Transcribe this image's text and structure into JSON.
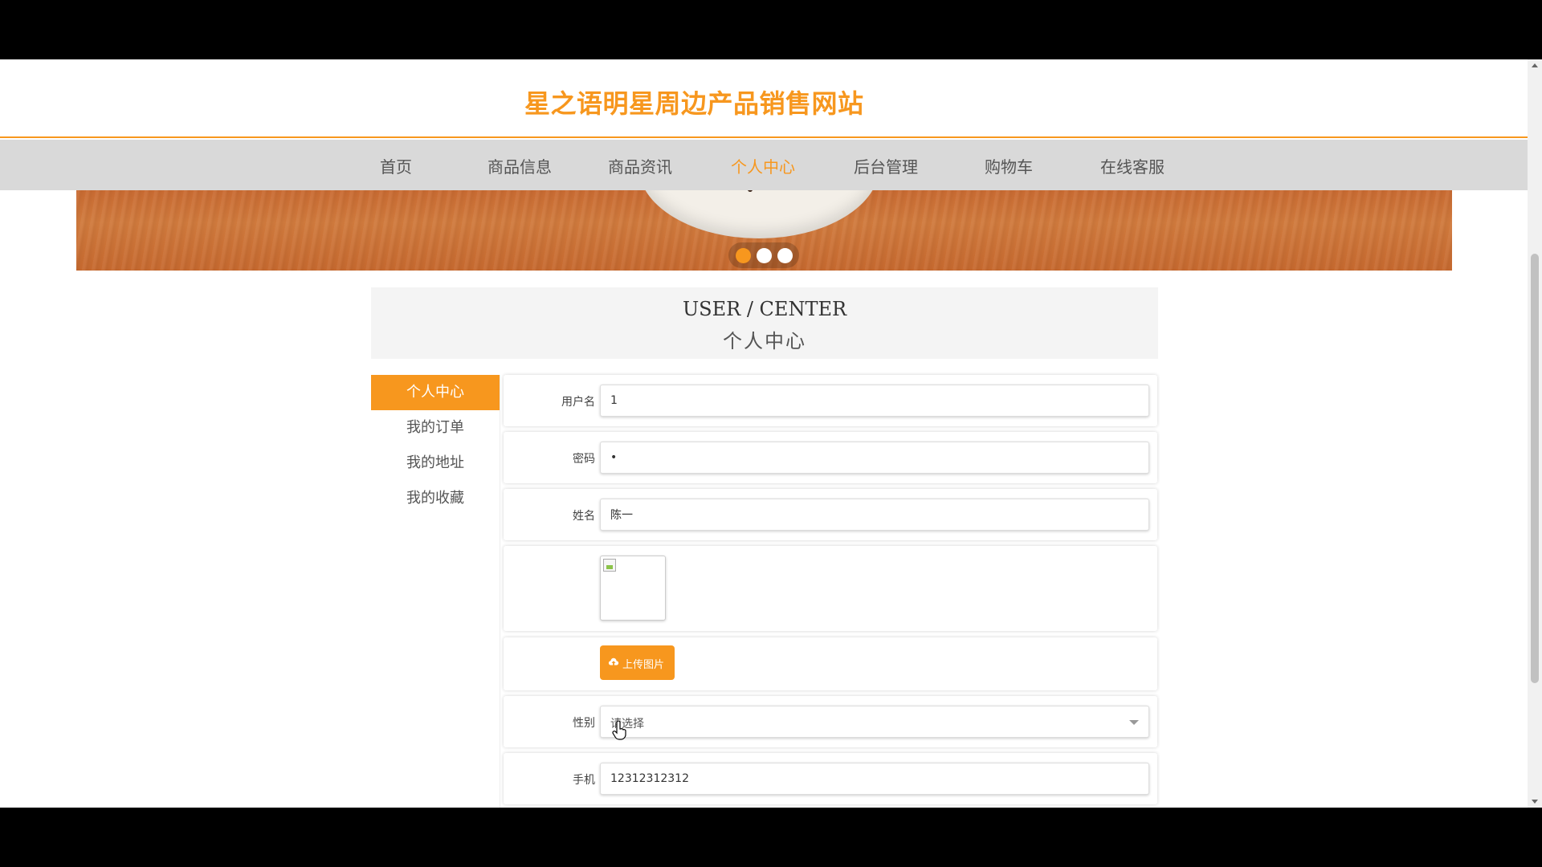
{
  "site": {
    "title": "星之语明星周边产品销售网站"
  },
  "nav": [
    {
      "label": "首页"
    },
    {
      "label": "商品信息"
    },
    {
      "label": "商品资讯"
    },
    {
      "label": "个人中心",
      "active": true
    },
    {
      "label": "后台管理"
    },
    {
      "label": "购物车"
    },
    {
      "label": "在线客服"
    }
  ],
  "banner": {
    "slides": 3,
    "active_slide": 1
  },
  "section": {
    "title_en": "USER / CENTER",
    "title_cn": "个人中心"
  },
  "sidebar": {
    "items": [
      {
        "label": "个人中心",
        "active": true
      },
      {
        "label": "我的订单"
      },
      {
        "label": "我的地址"
      },
      {
        "label": "我的收藏"
      }
    ]
  },
  "form": {
    "username": {
      "label": "用户名",
      "value": "1"
    },
    "password": {
      "label": "密码",
      "value": "•"
    },
    "name": {
      "label": "姓名",
      "value": "陈一"
    },
    "upload": {
      "label": "上传图片"
    },
    "gender": {
      "label": "性别",
      "placeholder": "请选择"
    },
    "phone": {
      "label": "手机",
      "value": "12312312312"
    }
  },
  "colors": {
    "accent": "#f7971e",
    "nav_bg": "#d9d9d9",
    "title_box_bg": "#f4f4f4"
  }
}
